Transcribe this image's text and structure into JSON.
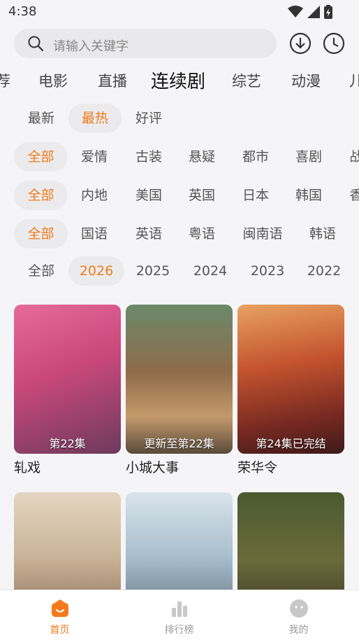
{
  "status_bar": {
    "time": "4:38"
  },
  "search": {
    "placeholder": "请输入关键字"
  },
  "category_tabs": [
    "荐",
    "电影",
    "直播",
    "连续剧",
    "综艺",
    "动漫",
    "儿"
  ],
  "active_category": "连续剧",
  "filters": {
    "sort": [
      "最新",
      "最热",
      "好评"
    ],
    "genre": [
      "全部",
      "爱情",
      "古装",
      "悬疑",
      "都市",
      "喜剧",
      "战"
    ],
    "region": [
      "全部",
      "内地",
      "美国",
      "英国",
      "日本",
      "韩国",
      "香"
    ],
    "language": [
      "全部",
      "国语",
      "英语",
      "粤语",
      "闽南语",
      "韩语"
    ],
    "year": [
      "全部",
      "2026",
      "2025",
      "2024",
      "2023",
      "2022"
    ]
  },
  "selected": {
    "sort": "最热",
    "genre": "全部",
    "region": "全部",
    "language": "全部",
    "year": "2026"
  },
  "cards": [
    {
      "title": "轧戏",
      "caption": "第22集"
    },
    {
      "title": "小城大事",
      "caption": "更新至第22集"
    },
    {
      "title": "荣华令",
      "caption": "第24集已完结"
    },
    {
      "title": "",
      "caption": ""
    },
    {
      "title": "",
      "caption": ""
    },
    {
      "title": "",
      "caption": ""
    }
  ],
  "bottom_nav": [
    {
      "label": "首页",
      "icon": "home-icon",
      "active": true
    },
    {
      "label": "排行榜",
      "icon": "ranking-icon",
      "active": false
    },
    {
      "label": "我的",
      "icon": "profile-icon",
      "active": false
    }
  ],
  "colors": {
    "accent": "#f27a1a",
    "chip_bg": "#ebebed",
    "background": "#f5f5f7"
  }
}
